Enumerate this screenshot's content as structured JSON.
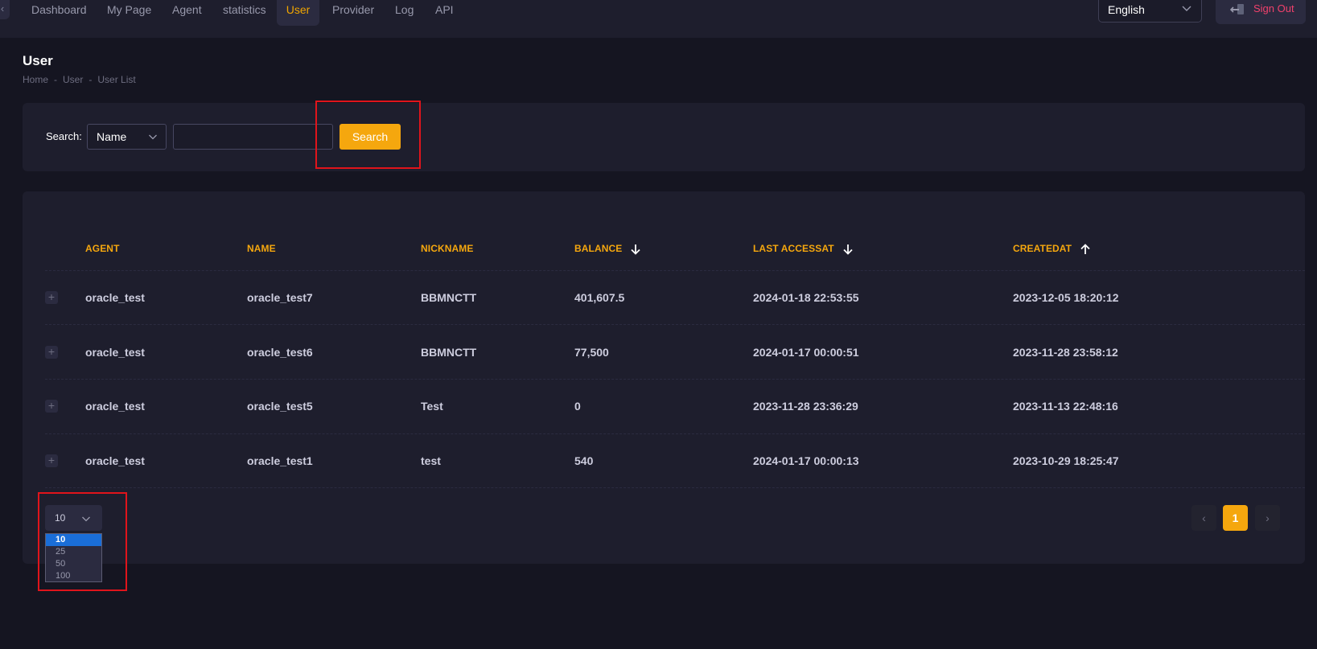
{
  "nav": {
    "back_glyph": "‹",
    "items": [
      {
        "label": "Dashboard",
        "active": false
      },
      {
        "label": "My Page",
        "active": false
      },
      {
        "label": "Agent",
        "active": false
      },
      {
        "label": "statistics",
        "active": false
      },
      {
        "label": "User",
        "active": true
      },
      {
        "label": "Provider",
        "active": false
      },
      {
        "label": "Log",
        "active": false
      },
      {
        "label": "API",
        "active": false
      }
    ],
    "language": "English",
    "sign_out": "Sign Out"
  },
  "page": {
    "title": "User",
    "breadcrumb": [
      "Home",
      "User",
      "User List"
    ],
    "breadcrumb_separator": "-"
  },
  "search": {
    "label": "Search:",
    "type_selected": "Name",
    "input_value": "",
    "button_label": "Search"
  },
  "table": {
    "columns": [
      {
        "label": "AGENT",
        "sort": null
      },
      {
        "label": "NAME",
        "sort": null
      },
      {
        "label": "NICKNAME",
        "sort": null
      },
      {
        "label": "BALANCE",
        "sort": "down"
      },
      {
        "label": "LAST ACCESSAT",
        "sort": "down"
      },
      {
        "label": "CREATEDAT",
        "sort": "up"
      }
    ],
    "expand_glyph": "+",
    "rows": [
      [
        "oracle_test",
        "oracle_test7",
        "BBMNCTT",
        "401,607.5",
        "2024-01-18 22:53:55",
        "2023-12-05 18:20:12"
      ],
      [
        "oracle_test",
        "oracle_test6",
        "BBMNCTT",
        "77,500",
        "2024-01-17 00:00:51",
        "2023-11-28 23:58:12"
      ],
      [
        "oracle_test",
        "oracle_test5",
        "Test",
        "0",
        "2023-11-28 23:36:29",
        "2023-11-13 22:48:16"
      ],
      [
        "oracle_test",
        "oracle_test1",
        "test",
        "540",
        "2024-01-17 00:00:13",
        "2023-10-29 18:25:47"
      ]
    ]
  },
  "pagination": {
    "page_size": "10",
    "page_size_options": [
      "10",
      "25",
      "50",
      "100"
    ],
    "prev_glyph": "‹",
    "next_glyph": "›",
    "current_page": "1"
  },
  "colors": {
    "accent": "#f5a70e",
    "sign_out": "#f1416c",
    "highlight_box": "#e0141b",
    "selected_option": "#1a6ed8"
  }
}
